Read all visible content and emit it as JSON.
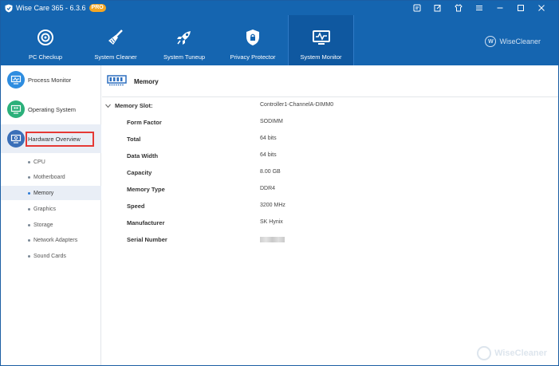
{
  "titlebar": {
    "title": "Wise Care 365 - 6.3.6",
    "badge": "PRO",
    "controls": [
      "feedback-icon",
      "notes-icon",
      "skin-icon",
      "menu-icon",
      "minimize-icon",
      "maximize-icon",
      "close-icon"
    ]
  },
  "topnav": {
    "items": [
      {
        "label": "PC Checkup",
        "icon": "target-icon"
      },
      {
        "label": "System Cleaner",
        "icon": "broom-icon"
      },
      {
        "label": "System Tuneup",
        "icon": "rocket-icon"
      },
      {
        "label": "Privacy Protector",
        "icon": "shield-icon"
      },
      {
        "label": "System Monitor",
        "icon": "monitor-icon",
        "active": true
      }
    ],
    "brand": {
      "logo": "W",
      "name": "WiseCleaner"
    }
  },
  "sidebar": {
    "sections": [
      {
        "label": "Process Monitor",
        "icon": "process-monitor-icon",
        "color": "#2e8de0"
      },
      {
        "label": "Operating System",
        "icon": "operating-system-icon",
        "color": "#2bb07a"
      },
      {
        "label": "Hardware Overview",
        "icon": "hardware-overview-icon",
        "color": "#3a6fb8"
      }
    ],
    "subitems": [
      "CPU",
      "Motherboard",
      "Memory",
      "Graphics",
      "Storage",
      "Network Adapters",
      "Sound Cards"
    ],
    "selected_subitem": "Memory"
  },
  "content": {
    "header_title": "Memory",
    "slot": {
      "label": "Memory Slot:",
      "value": "Controller1-ChannelA-DIMM0"
    },
    "props": [
      {
        "key": "Form Factor",
        "value": "SODIMM"
      },
      {
        "key": "Total",
        "value": "64 bits"
      },
      {
        "key": "Data Width",
        "value": "64 bits"
      },
      {
        "key": "Capacity",
        "value": "8.00 GB"
      },
      {
        "key": "Memory Type",
        "value": "DDR4"
      },
      {
        "key": "Speed",
        "value": "3200 MHz"
      },
      {
        "key": "Manufacturer",
        "value": "SK Hynix"
      },
      {
        "key": "Serial Number",
        "value": ""
      }
    ]
  },
  "watermark": {
    "name": "WiseCleaner"
  },
  "colors": {
    "primary": "#1565b0",
    "badge": "#f4a623",
    "highlight": "#e53935",
    "selected_bg": "#e9eef6"
  }
}
